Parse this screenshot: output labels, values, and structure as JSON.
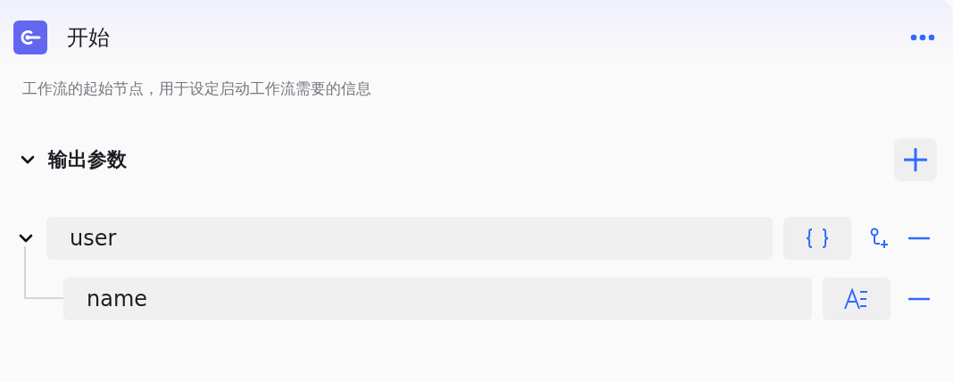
{
  "node": {
    "title": "开始",
    "description": "工作流的起始节点，用于设定启动工作流需要的信息"
  },
  "section": {
    "title": "输出参数",
    "expanded": true
  },
  "params": [
    {
      "value": "user",
      "kind": "object",
      "expanded": true,
      "children": [
        {
          "value": "name",
          "kind": "string"
        }
      ]
    }
  ]
}
